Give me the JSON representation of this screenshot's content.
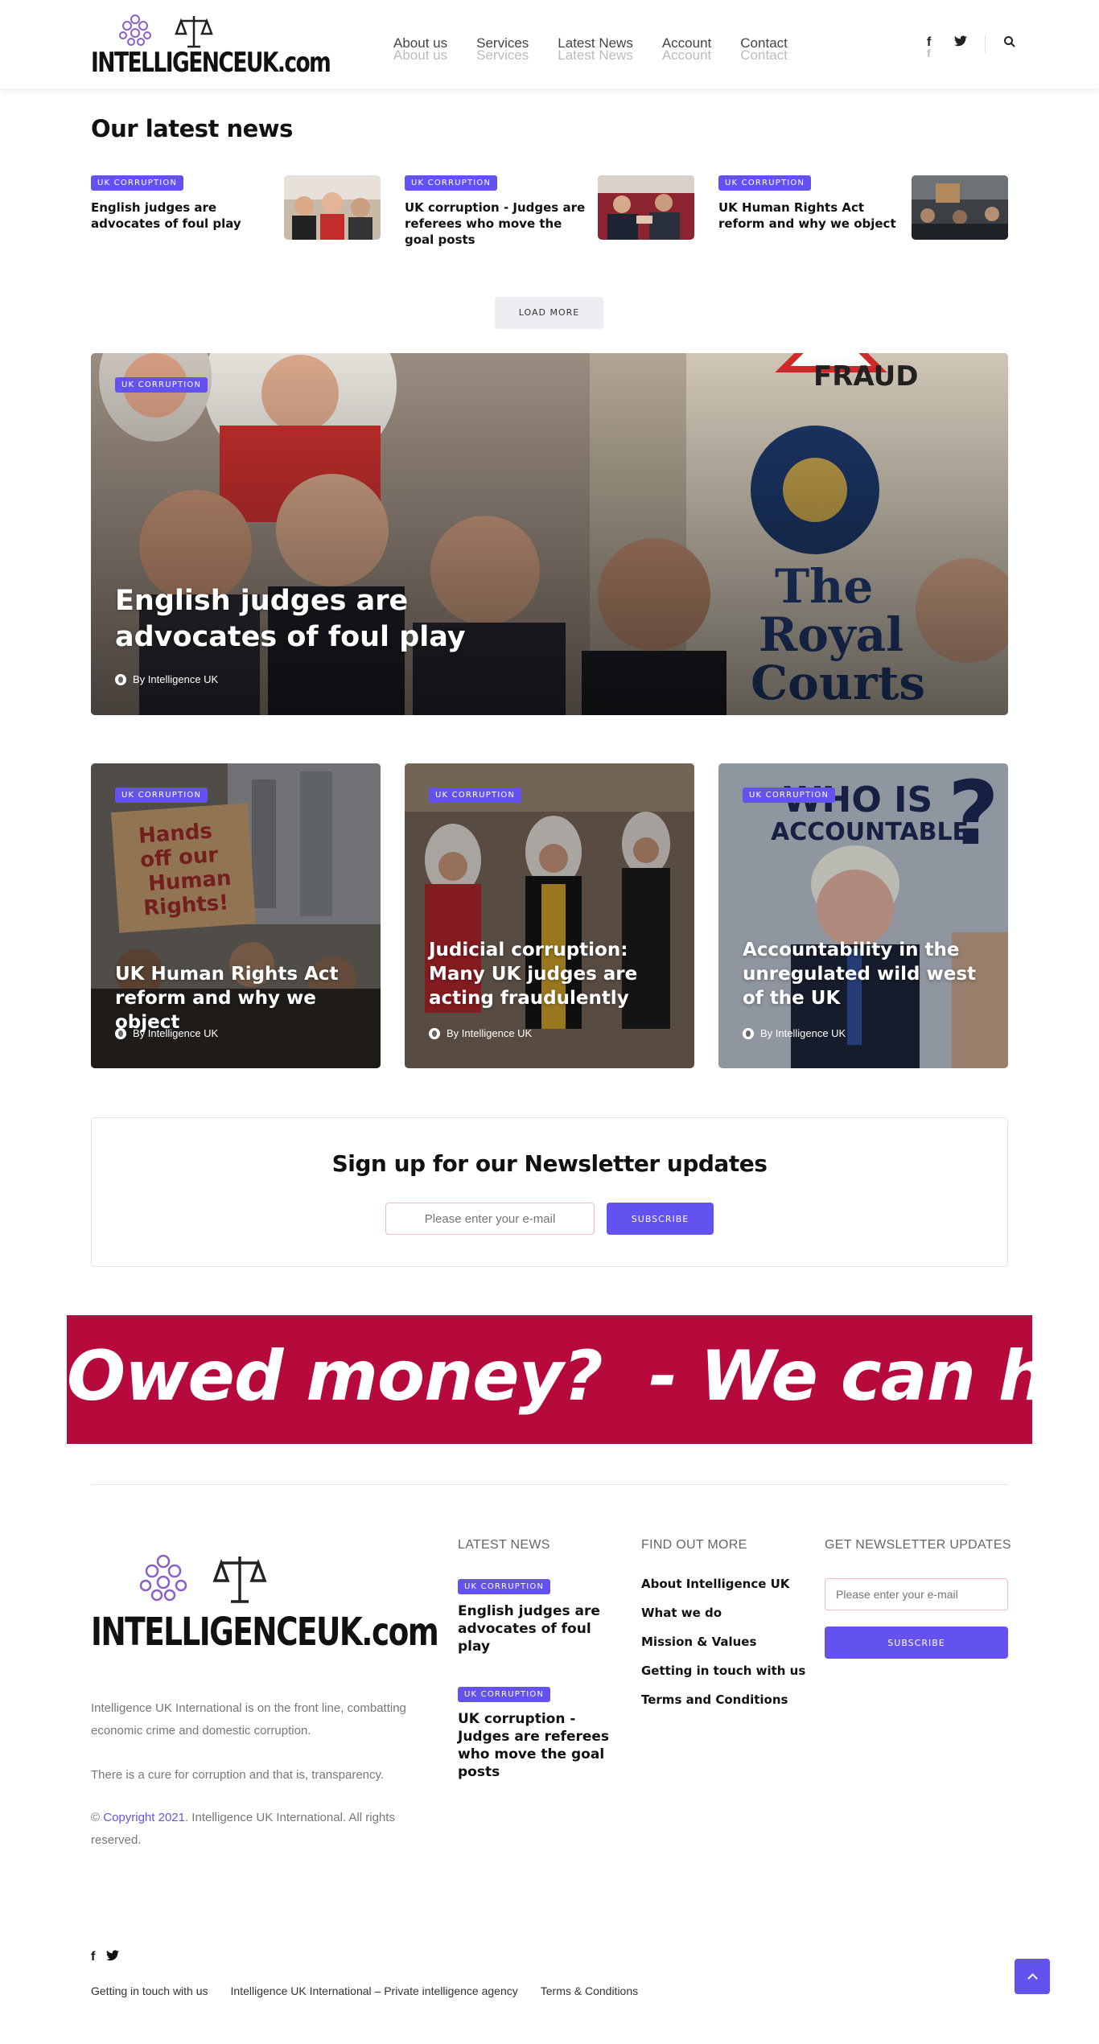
{
  "header": {
    "logo_text": "INTELLIGENCEUK.com",
    "nav": [
      "About us",
      "Services",
      "Latest News",
      "Account",
      "Contact"
    ],
    "icons": [
      "facebook-icon",
      "twitter-icon",
      "search-icon"
    ]
  },
  "latest": {
    "title": "Our latest news",
    "items": [
      {
        "badge": "UK CORRUPTION",
        "title": "English judges are advocates of foul play"
      },
      {
        "badge": "UK CORRUPTION",
        "title": "UK corruption - Judges are referees who move the goal posts"
      },
      {
        "badge": "UK CORRUPTION",
        "title": "UK Human Rights Act reform and why we object"
      }
    ],
    "load_more": "LOAD MORE"
  },
  "hero": {
    "badge": "UK CORRUPTION",
    "title": "English judges are advocates of foul play",
    "byline": "By Intelligence UK"
  },
  "cards": [
    {
      "badge": "UK CORRUPTION",
      "title": "UK Human Rights Act reform and why we object",
      "byline": "By Intelligence UK",
      "sign_text": "Hands off our Human Rights!"
    },
    {
      "badge": "UK CORRUPTION",
      "title": "Judicial corruption: Many UK judges are acting fraudulently",
      "byline": "By Intelligence UK"
    },
    {
      "badge": "UK CORRUPTION",
      "title": "Accountability in the unregulated wild west of the UK",
      "byline": "By Intelligence UK",
      "image_text": "WHO IS ACCOUNTABLE"
    }
  ],
  "newsletter": {
    "title": "Sign up for our Newsletter updates",
    "placeholder": "Please enter your e-mail",
    "button": "SUBSCRIBE"
  },
  "banner": {
    "text": "Owed money?  - We can help",
    "color": "#b60a3c"
  },
  "footer": {
    "logo_text": "INTELLIGENCEUK.com",
    "desc1": "Intelligence UK International is on the front line, combatting economic crime and domestic corruption.",
    "desc2": "There is a cure for corruption and that is, transparency.",
    "copyright_prefix": "©",
    "copyright_link": "Copyright 2021",
    "copyright_suffix": ". Intelligence UK International. All rights reserved.",
    "col_news_title": "LATEST NEWS",
    "news": [
      {
        "badge": "UK CORRUPTION",
        "title": "English judges are advocates of foul play"
      },
      {
        "badge": "UK CORRUPTION",
        "title": "UK corruption - Judges are referees who move the goal posts"
      }
    ],
    "col_more_title": "FIND OUT MORE",
    "links": [
      "About Intelligence UK",
      "What we do",
      "Mission & Values",
      "Getting in touch with us",
      "Terms and Conditions"
    ],
    "col_nl_title": "GET NEWSLETTER UPDATES",
    "placeholder": "Please enter your e-mail",
    "button": "SUBSCRIBE",
    "bottom_links": [
      "Getting in touch with us",
      "Intelligence UK International – Private intelligence agency",
      "Terms & Conditions"
    ]
  },
  "colors": {
    "accent": "#6352f0",
    "banner": "#b60a3c"
  }
}
